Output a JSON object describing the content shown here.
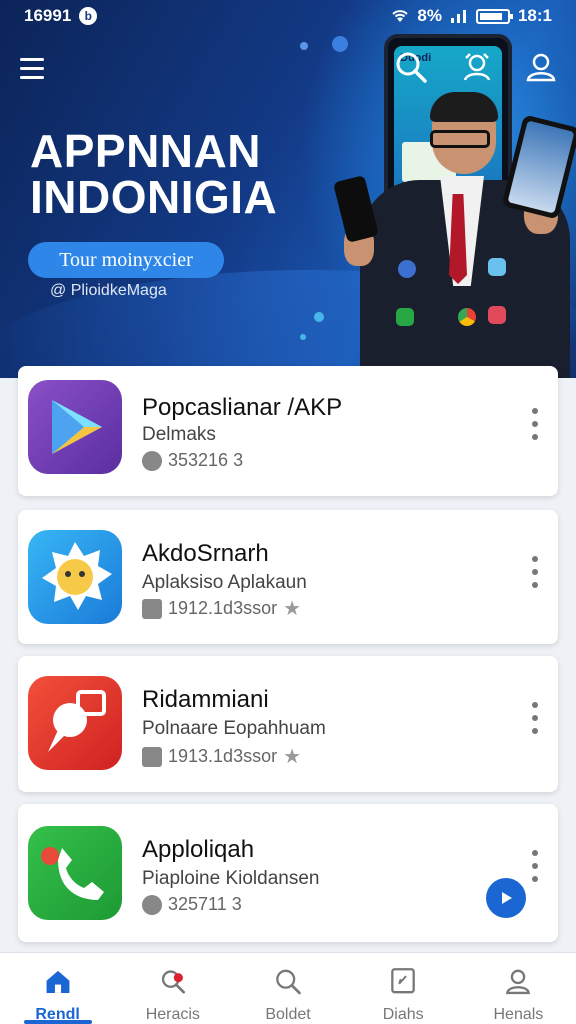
{
  "status_bar": {
    "time_left": "16991",
    "signal_text": "8%",
    "clock": "18:1"
  },
  "header": {
    "menu_icon": "hamburger-icon",
    "search_icon": "search-icon",
    "ai_icon": "user-circle-icon",
    "profile_icon": "profile-icon"
  },
  "hero": {
    "title_line1": "APPNNAN",
    "title_line2": "INDONIGIA",
    "cta_label": "Tour moinyxcier",
    "credit": "@ PlioidkeMaga",
    "phone_header": "Duodi"
  },
  "apps": [
    {
      "title": "Popcaslianar /AKP",
      "subtitle": "Delmaks",
      "meta": "353216 3",
      "meta_icon": "download-icon",
      "icon": "play-store-icon"
    },
    {
      "title": "AkdoSrnarh",
      "subtitle": "Aplaksiso Aplakaun",
      "meta": "1912.1d3ssor",
      "meta_icon": "install-icon",
      "icon": "sun-face-icon",
      "rating_icon": "star-icon"
    },
    {
      "title": "Ridammiani",
      "subtitle": "Polnaare Eopahhuam",
      "meta": "1913.1d3ssor",
      "meta_icon": "install-icon",
      "icon": "chat-pin-icon",
      "rating_icon": "star-icon"
    },
    {
      "title": "Apploliqah",
      "subtitle": "Piaploine Kioldansen",
      "meta": "325711 3",
      "meta_icon": "download-icon",
      "icon": "phone-call-icon",
      "action_icon": "play-icon"
    }
  ],
  "nav": [
    {
      "label": "Rendl",
      "icon": "home-icon",
      "active": true
    },
    {
      "label": "Heracis",
      "icon": "search-badge-icon"
    },
    {
      "label": "Boldet",
      "icon": "search-icon"
    },
    {
      "label": "Diahs",
      "icon": "document-icon"
    },
    {
      "label": "Henals",
      "icon": "account-icon"
    }
  ],
  "colors": {
    "accent": "#1a66d2",
    "hero_dark": "#0c2458",
    "cta": "#2e86e8"
  }
}
